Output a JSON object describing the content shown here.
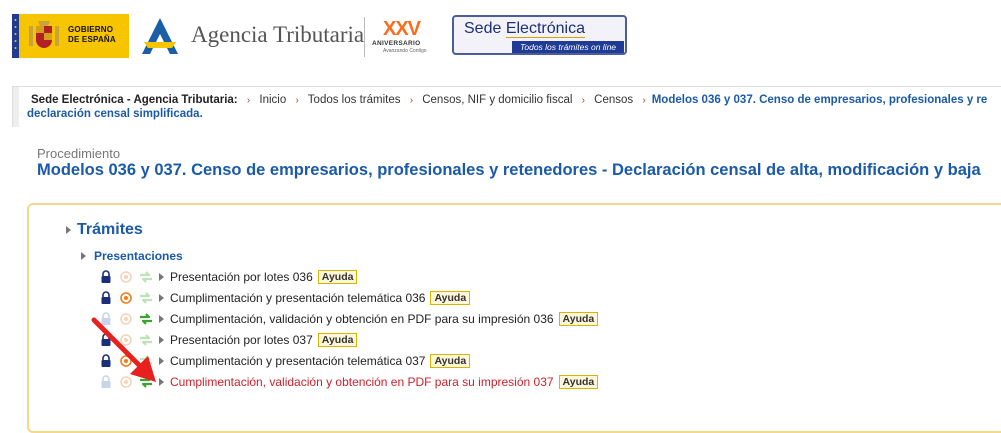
{
  "header": {
    "gov_line1": "GOBIERNO",
    "gov_line2": "DE ESPAÑA",
    "agency_name": "Agencia Tributaria",
    "anniv_number": "XXV",
    "anniv_label": "ANIVERSARIO",
    "anniv_tag": "Avanzando Contigo",
    "sede_title_a": "Sede ",
    "sede_title_b": "Electrónica",
    "sede_subtitle": "Todos los trámites on line"
  },
  "breadcrumb": {
    "root": "Sede Electrónica - Agencia Tributaria:",
    "items": [
      "Inicio",
      "Todos los trámites",
      "Censos, NIF y domicilio fiscal",
      "Censos"
    ],
    "current_line1": "Modelos 036 y 037. Censo de empresarios, profesionales y re",
    "current_line2": "declaración censal simplificada."
  },
  "procedure": {
    "label": "Procedimiento",
    "title": "Modelos 036 y 037. Censo de empresarios, profesionales y retenedores - Declaración censal de alta, modificación y baja"
  },
  "tramites": {
    "heading": "Trámites",
    "section": "Presentaciones",
    "help_label": "Ayuda",
    "items": [
      {
        "label": "Presentación por lotes 036",
        "lock": "dark",
        "cert": "faded",
        "sync": "faded"
      },
      {
        "label": "Cumplimentación y presentación telemática 036",
        "lock": "dark",
        "cert": "active",
        "sync": "faded"
      },
      {
        "label": "Cumplimentación, validación y obtención en PDF para su impresión 036",
        "lock": "faded",
        "cert": "faded",
        "sync": "active"
      },
      {
        "label": "Presentación por lotes 037",
        "lock": "dark",
        "cert": "faded",
        "sync": "faded"
      },
      {
        "label": "Cumplimentación y presentación telemática 037",
        "lock": "dark",
        "cert": "active",
        "sync": "faded"
      },
      {
        "label": "Cumplimentación, validación y obtención en PDF para su impresión 037",
        "lock": "faded",
        "cert": "faded",
        "sync": "active",
        "highlighted": true
      }
    ]
  },
  "colors": {
    "link_blue": "#1a5aa8",
    "highlight_red": "#d0202a",
    "panel_border": "#f4d98c",
    "annotation_arrow": "#e8201e"
  }
}
